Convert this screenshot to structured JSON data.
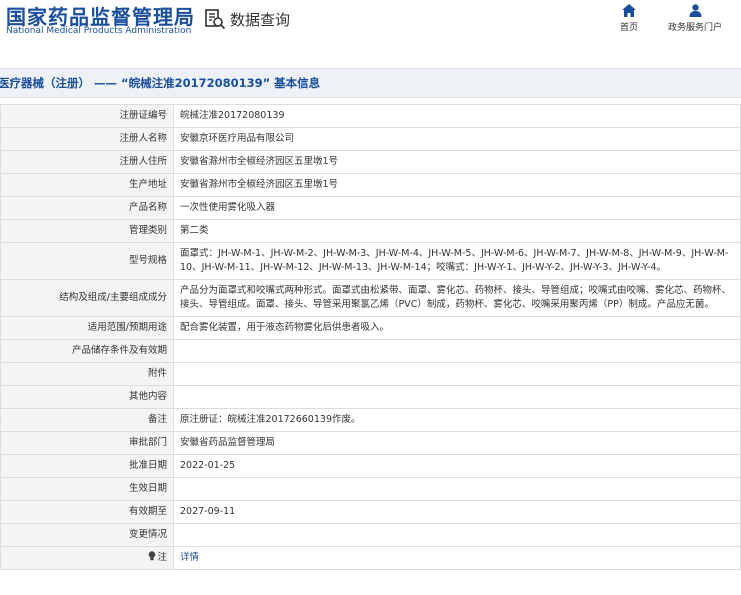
{
  "header": {
    "logo_cn": "国家药品监督管理局",
    "logo_en": "National Medical Products Administration",
    "query_title": "数据查询",
    "nav": [
      {
        "label": "首页",
        "icon": "home-icon"
      },
      {
        "label": "政务服务门户",
        "icon": "user-icon"
      }
    ]
  },
  "page_title": "医疗器械（注册） —— “皖械注准20172080139” 基本信息",
  "rows": [
    {
      "label": "注册证编号",
      "value": "皖械注准20172080139"
    },
    {
      "label": "注册人名称",
      "value": "安徽京环医疗用品有限公司"
    },
    {
      "label": "注册人住所",
      "value": "安徽省滁州市全椒经济园区五里墩1号"
    },
    {
      "label": "生产地址",
      "value": "安徽省滁州市全椒经济园区五里墩1号"
    },
    {
      "label": "产品名称",
      "value": "一次性使用雾化吸入器"
    },
    {
      "label": "管理类别",
      "value": "第二类"
    },
    {
      "label": "型号规格",
      "value": "面罩式：JH-W-M-1、JH-W-M-2、JH-W-M-3、JH-W-M-4、JH-W-M-5、JH-W-M-6、JH-W-M-7、JH-W-M-8、JH-W-M-9、JH-W-M-10、JH-W-M-11、JH-W-M-12、JH-W-M-13、JH-W-M-14；咬嘴式：JH-W-Y-1、JH-W-Y-2、JH-W-Y-3、JH-W-Y-4。"
    },
    {
      "label": "结构及组成/主要组成成分",
      "value": "产品分为面罩式和咬嘴式两种形式。面罩式由松紧带、面罩、雾化芯、药物杯、接头、导管组成；咬嘴式由咬嘴、雾化芯、药物杯、接头、导管组成。面罩、接头、导管采用聚氯乙烯（PVC）制成，药物杯、雾化芯、咬嘴采用聚丙烯（PP）制成。产品应无菌。"
    },
    {
      "label": "适用范围/预期用途",
      "value": "配合雾化装置，用于液态药物雾化后供患者吸入。"
    },
    {
      "label": "产品储存条件及有效期",
      "value": ""
    },
    {
      "label": "附件",
      "value": ""
    },
    {
      "label": "其他内容",
      "value": ""
    },
    {
      "label": "备注",
      "value": "原注册证：皖械注准20172660139作废。"
    },
    {
      "label": "审批部门",
      "value": "安徽省药品监督管理局"
    },
    {
      "label": "批准日期",
      "value": "2022-01-25"
    },
    {
      "label": "生效日期",
      "value": ""
    },
    {
      "label": "有效期至",
      "value": "2027-09-11"
    },
    {
      "label": "变更情况",
      "value": ""
    },
    {
      "label": "注",
      "value": "详情",
      "icon": "lightbulb-icon"
    }
  ]
}
